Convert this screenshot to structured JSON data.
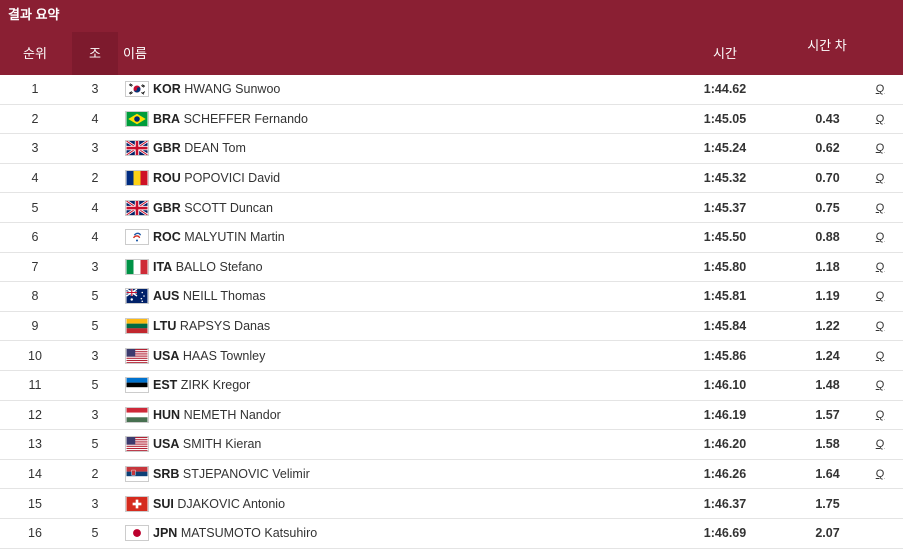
{
  "header": {
    "title": "결과 요약",
    "col_rank": "순위",
    "col_heat": "조",
    "col_name": "이름",
    "col_time": "시간",
    "col_diff": "시간 차"
  },
  "qualifier_mark": "Q",
  "rows": [
    {
      "rank": "1",
      "heat": "3",
      "noc": "KOR",
      "name": "HWANG Sunwoo",
      "time": "1:44.62",
      "diff": "",
      "q": true,
      "flag": "kor-flag-icon"
    },
    {
      "rank": "2",
      "heat": "4",
      "noc": "BRA",
      "name": "SCHEFFER Fernando",
      "time": "1:45.05",
      "diff": "0.43",
      "q": true,
      "flag": "bra-flag-icon"
    },
    {
      "rank": "3",
      "heat": "3",
      "noc": "GBR",
      "name": "DEAN Tom",
      "time": "1:45.24",
      "diff": "0.62",
      "q": true,
      "flag": "gbr-flag-icon"
    },
    {
      "rank": "4",
      "heat": "2",
      "noc": "ROU",
      "name": "POPOVICI David",
      "time": "1:45.32",
      "diff": "0.70",
      "q": true,
      "flag": "rou-flag-icon"
    },
    {
      "rank": "5",
      "heat": "4",
      "noc": "GBR",
      "name": "SCOTT Duncan",
      "time": "1:45.37",
      "diff": "0.75",
      "q": true,
      "flag": "gbr-flag-icon"
    },
    {
      "rank": "6",
      "heat": "4",
      "noc": "ROC",
      "name": "MALYUTIN Martin",
      "time": "1:45.50",
      "diff": "0.88",
      "q": true,
      "flag": "roc-flag-icon"
    },
    {
      "rank": "7",
      "heat": "3",
      "noc": "ITA",
      "name": "BALLO Stefano",
      "time": "1:45.80",
      "diff": "1.18",
      "q": true,
      "flag": "ita-flag-icon"
    },
    {
      "rank": "8",
      "heat": "5",
      "noc": "AUS",
      "name": "NEILL Thomas",
      "time": "1:45.81",
      "diff": "1.19",
      "q": true,
      "flag": "aus-flag-icon"
    },
    {
      "rank": "9",
      "heat": "5",
      "noc": "LTU",
      "name": "RAPSYS Danas",
      "time": "1:45.84",
      "diff": "1.22",
      "q": true,
      "flag": "ltu-flag-icon"
    },
    {
      "rank": "10",
      "heat": "3",
      "noc": "USA",
      "name": "HAAS Townley",
      "time": "1:45.86",
      "diff": "1.24",
      "q": true,
      "flag": "usa-flag-icon"
    },
    {
      "rank": "11",
      "heat": "5",
      "noc": "EST",
      "name": "ZIRK Kregor",
      "time": "1:46.10",
      "diff": "1.48",
      "q": true,
      "flag": "est-flag-icon"
    },
    {
      "rank": "12",
      "heat": "3",
      "noc": "HUN",
      "name": "NEMETH Nandor",
      "time": "1:46.19",
      "diff": "1.57",
      "q": true,
      "flag": "hun-flag-icon"
    },
    {
      "rank": "13",
      "heat": "5",
      "noc": "USA",
      "name": "SMITH Kieran",
      "time": "1:46.20",
      "diff": "1.58",
      "q": true,
      "flag": "usa-flag-icon"
    },
    {
      "rank": "14",
      "heat": "2",
      "noc": "SRB",
      "name": "STJEPANOVIC Velimir",
      "time": "1:46.26",
      "diff": "1.64",
      "q": true,
      "flag": "srb-flag-icon"
    },
    {
      "rank": "15",
      "heat": "3",
      "noc": "SUI",
      "name": "DJAKOVIC Antonio",
      "time": "1:46.37",
      "diff": "1.75",
      "q": false,
      "flag": "sui-flag-icon"
    },
    {
      "rank": "16",
      "heat": "5",
      "noc": "JPN",
      "name": "MATSUMOTO Katsuhiro",
      "time": "1:46.69",
      "diff": "2.07",
      "q": false,
      "flag": "jpn-flag-icon"
    }
  ],
  "colors": {
    "header_bg": "#8a1f33",
    "header_text": "#ffffff"
  }
}
